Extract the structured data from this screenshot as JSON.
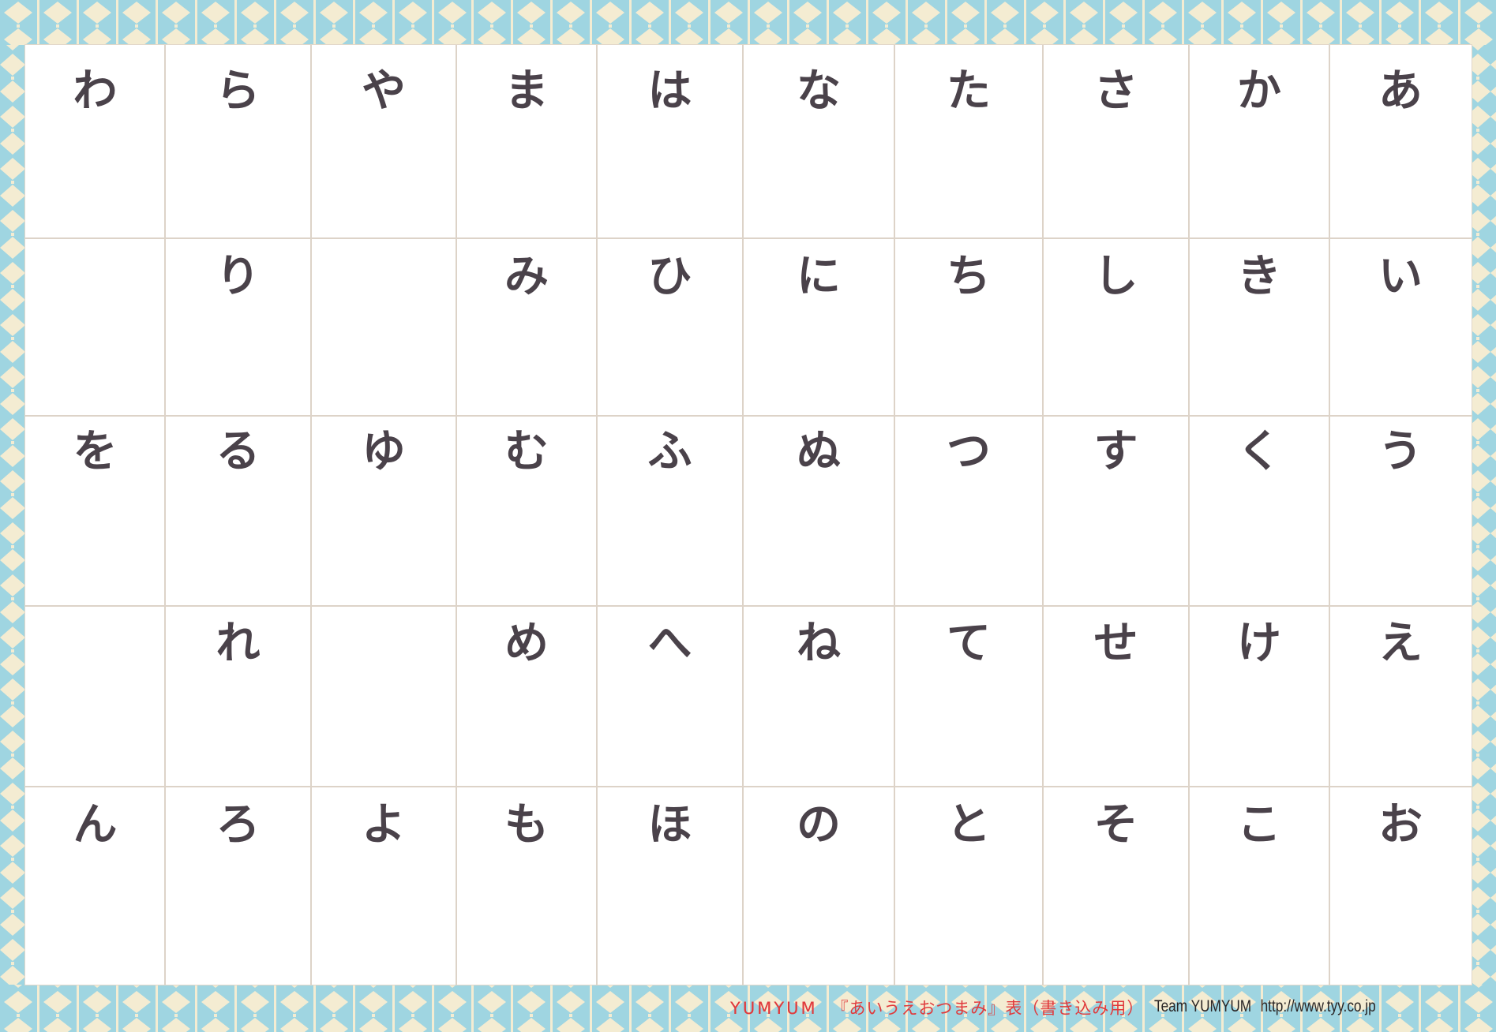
{
  "chart": {
    "columns": [
      [
        "わ",
        "",
        "を",
        "",
        "ん"
      ],
      [
        "ら",
        "り",
        "る",
        "れ",
        "ろ"
      ],
      [
        "や",
        "",
        "ゆ",
        "",
        "よ"
      ],
      [
        "ま",
        "み",
        "む",
        "め",
        "も"
      ],
      [
        "は",
        "ひ",
        "ふ",
        "へ",
        "ほ"
      ],
      [
        "な",
        "に",
        "ぬ",
        "ね",
        "の"
      ],
      [
        "た",
        "ち",
        "つ",
        "て",
        "と"
      ],
      [
        "さ",
        "し",
        "す",
        "せ",
        "そ"
      ],
      [
        "か",
        "き",
        "く",
        "け",
        "こ"
      ],
      [
        "あ",
        "い",
        "う",
        "え",
        "お"
      ]
    ]
  },
  "footer": {
    "brand": "YUMYUM",
    "title": "『あいうえおつまみ』表（書き込み用）",
    "team": "Team YUMYUM",
    "url": "http://www.tyy.co.jp"
  },
  "colors": {
    "border_blue": "#9fd5e1",
    "border_cream": "#f4ecd2",
    "ink": "#4a424a",
    "grid": "#ddd3c8",
    "footer_red": "#e03a3c"
  }
}
